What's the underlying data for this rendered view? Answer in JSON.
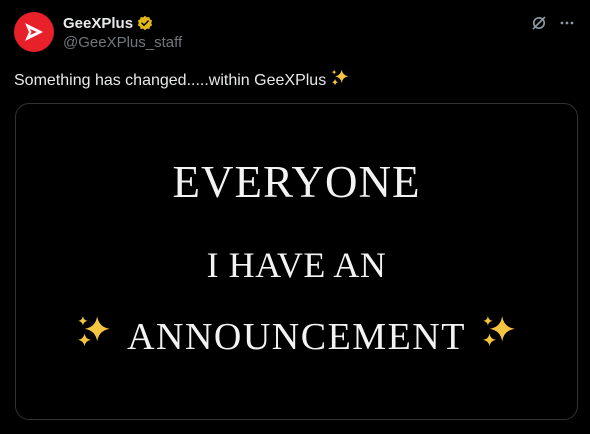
{
  "tweet": {
    "display_name": "GeeXPlus",
    "handle": "@GeeXPlus_staff",
    "text": "Something has changed.....within GeeXPlus",
    "text_emoji": "sparkles"
  },
  "media": {
    "line1": "EVERYONE",
    "line2": "I HAVE AN",
    "line3": "ANNOUNCEMENT"
  },
  "icons": {
    "avatar": "geexplus-logo",
    "verified": "verified-badge-icon",
    "grok": "grok-icon",
    "more": "more-icon",
    "sparkles": "sparkles-icon"
  },
  "colors": {
    "background": "#000000",
    "text": "#e7e9ea",
    "secondary_text": "#71767b",
    "brand_red": "#e8202a",
    "verified_gold": "#e2b719",
    "sparkle_gold": "#f5c542"
  }
}
